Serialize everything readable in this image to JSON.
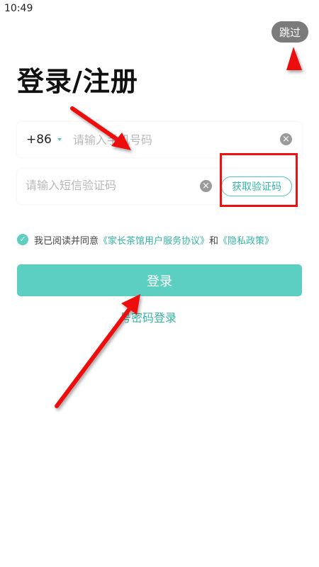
{
  "status_bar": {
    "time": "10:49"
  },
  "skip_label": "跳过",
  "title": "登录/注册",
  "phone": {
    "country_code": "+86",
    "placeholder": "请输入手机号码"
  },
  "code": {
    "placeholder": "请输入短信验证码",
    "get_code_label": "获取验证码"
  },
  "agreement": {
    "prefix": "我已阅读并同意",
    "link1": "《家长茶馆用户服务协议》",
    "and": "和",
    "link2": "《隐私政策》"
  },
  "login_label": "登录",
  "alt_login_label": "号密码登录",
  "colors": {
    "accent": "#5ccfc0",
    "annotation": "#e11111"
  },
  "icons": [
    "clear-icon",
    "check-icon",
    "caret-down-icon"
  ]
}
